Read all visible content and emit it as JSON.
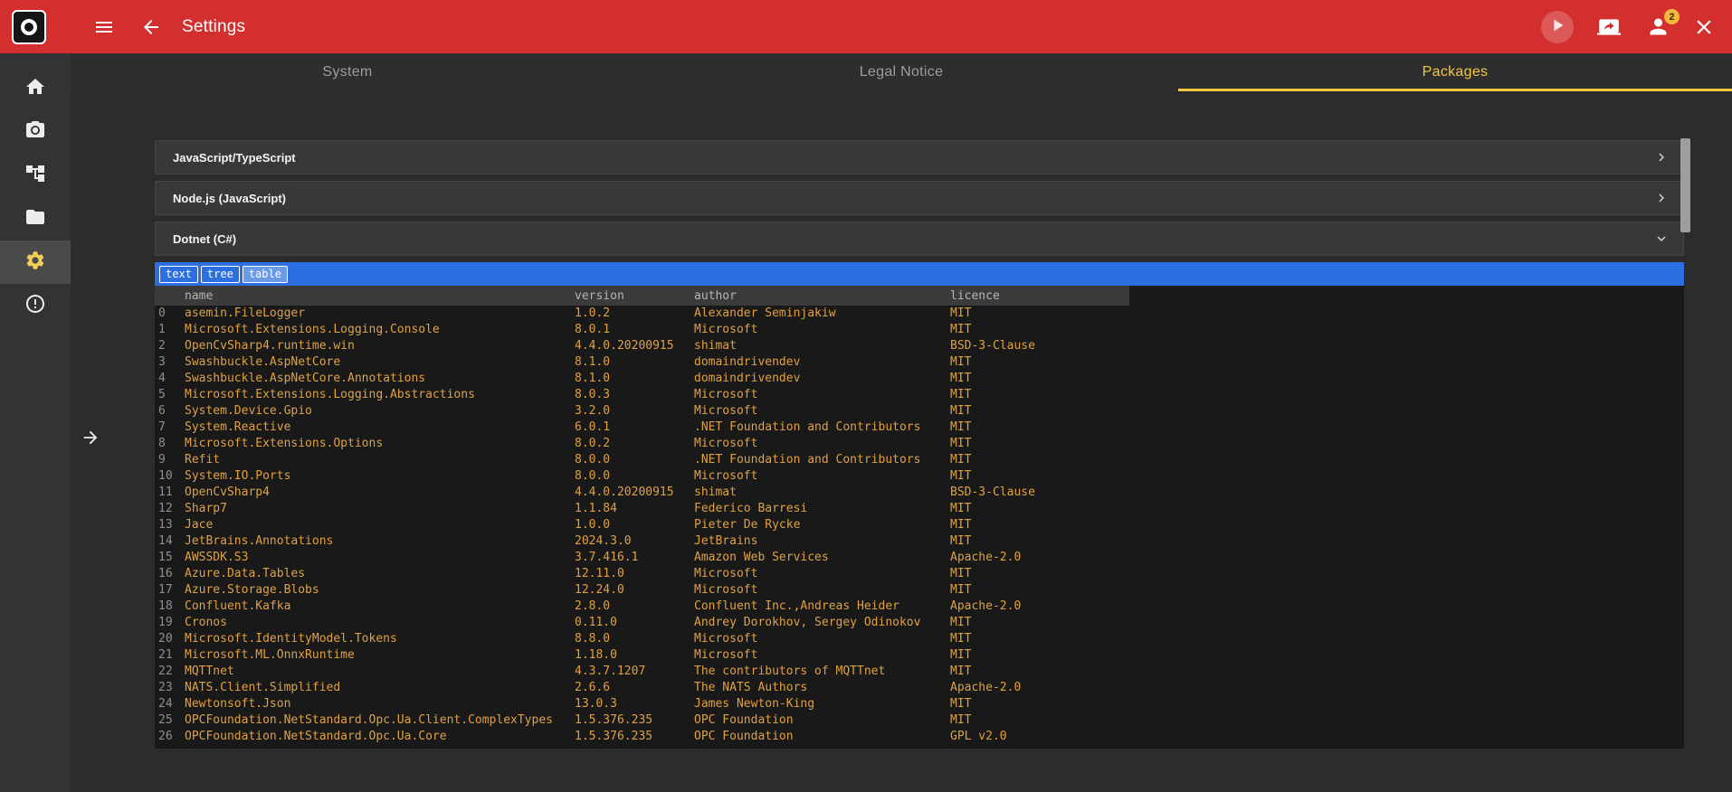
{
  "header": {
    "title": "Settings",
    "badge_count": "2"
  },
  "tabs": [
    {
      "label": "System",
      "active": false
    },
    {
      "label": "Legal Notice",
      "active": false
    },
    {
      "label": "Packages",
      "active": true
    }
  ],
  "sidebar": {
    "items": [
      {
        "name": "home",
        "active": false
      },
      {
        "name": "camera",
        "active": false
      },
      {
        "name": "process-tree",
        "active": false
      },
      {
        "name": "files",
        "active": false
      },
      {
        "name": "settings",
        "active": true
      },
      {
        "name": "alerts",
        "active": false
      }
    ]
  },
  "accordions": [
    {
      "label": "JavaScript/TypeScript",
      "expanded": false
    },
    {
      "label": "Node.js (JavaScript)",
      "expanded": false
    },
    {
      "label": "Dotnet (C#)",
      "expanded": true
    }
  ],
  "viewer": {
    "modes": [
      "text",
      "tree",
      "table"
    ],
    "active_mode": "table"
  },
  "packages_table": {
    "columns": [
      "name",
      "version",
      "author",
      "licence"
    ],
    "rows": [
      [
        "asemin.FileLogger",
        "1.0.2",
        "Alexander Seminjakiw",
        "MIT"
      ],
      [
        "Microsoft.Extensions.Logging.Console",
        "8.0.1",
        "Microsoft",
        "MIT"
      ],
      [
        "OpenCvSharp4.runtime.win",
        "4.4.0.20200915",
        "shimat",
        "BSD-3-Clause"
      ],
      [
        "Swashbuckle.AspNetCore",
        "8.1.0",
        "domaindrivendev",
        "MIT"
      ],
      [
        "Swashbuckle.AspNetCore.Annotations",
        "8.1.0",
        "domaindrivendev",
        "MIT"
      ],
      [
        "Microsoft.Extensions.Logging.Abstractions",
        "8.0.3",
        "Microsoft",
        "MIT"
      ],
      [
        "System.Device.Gpio",
        "3.2.0",
        "Microsoft",
        "MIT"
      ],
      [
        "System.Reactive",
        "6.0.1",
        ".NET Foundation and Contributors",
        "MIT"
      ],
      [
        "Microsoft.Extensions.Options",
        "8.0.2",
        "Microsoft",
        "MIT"
      ],
      [
        "Refit",
        "8.0.0",
        ".NET Foundation and Contributors",
        "MIT"
      ],
      [
        "System.IO.Ports",
        "8.0.0",
        "Microsoft",
        "MIT"
      ],
      [
        "OpenCvSharp4",
        "4.4.0.20200915",
        "shimat",
        "BSD-3-Clause"
      ],
      [
        "Sharp7",
        "1.1.84",
        "Federico Barresi",
        "MIT"
      ],
      [
        "Jace",
        "1.0.0",
        "Pieter De Rycke",
        "MIT"
      ],
      [
        "JetBrains.Annotations",
        "2024.3.0",
        "JetBrains",
        "MIT"
      ],
      [
        "AWSSDK.S3",
        "3.7.416.1",
        "Amazon Web Services",
        "Apache-2.0"
      ],
      [
        "Azure.Data.Tables",
        "12.11.0",
        "Microsoft",
        "MIT"
      ],
      [
        "Azure.Storage.Blobs",
        "12.24.0",
        "Microsoft",
        "MIT"
      ],
      [
        "Confluent.Kafka",
        "2.8.0",
        "Confluent Inc.,Andreas Heider",
        "Apache-2.0"
      ],
      [
        "Cronos",
        "0.11.0",
        "Andrey Dorokhov, Sergey Odinokov",
        "MIT"
      ],
      [
        "Microsoft.IdentityModel.Tokens",
        "8.8.0",
        "Microsoft",
        "MIT"
      ],
      [
        "Microsoft.ML.OnnxRuntime",
        "1.18.0",
        "Microsoft",
        "MIT"
      ],
      [
        "MQTTnet",
        "4.3.7.1207",
        "The contributors of MQTTnet",
        "MIT"
      ],
      [
        "NATS.Client.Simplified",
        "2.6.6",
        "The NATS Authors",
        "Apache-2.0"
      ],
      [
        "Newtonsoft.Json",
        "13.0.3",
        "James Newton-King",
        "MIT"
      ],
      [
        "OPCFoundation.NetStandard.Opc.Ua.Client.ComplexTypes",
        "1.5.376.235",
        "OPC Foundation",
        "MIT"
      ],
      [
        "OPCFoundation.NetStandard.Opc.Ua.Core",
        "1.5.376.235",
        "OPC Foundation",
        "GPL v2.0"
      ]
    ]
  },
  "colors": {
    "header_red": "#d32f2f",
    "accent_yellow": "#f3c73f",
    "toolbar_blue": "#2b6fe0",
    "table_text_orange": "#dfa144",
    "table_bg": "#191919",
    "sidebar_bg": "#333333",
    "page_bg": "#2c2c2c",
    "badge_yellow": "#f5b83d"
  }
}
